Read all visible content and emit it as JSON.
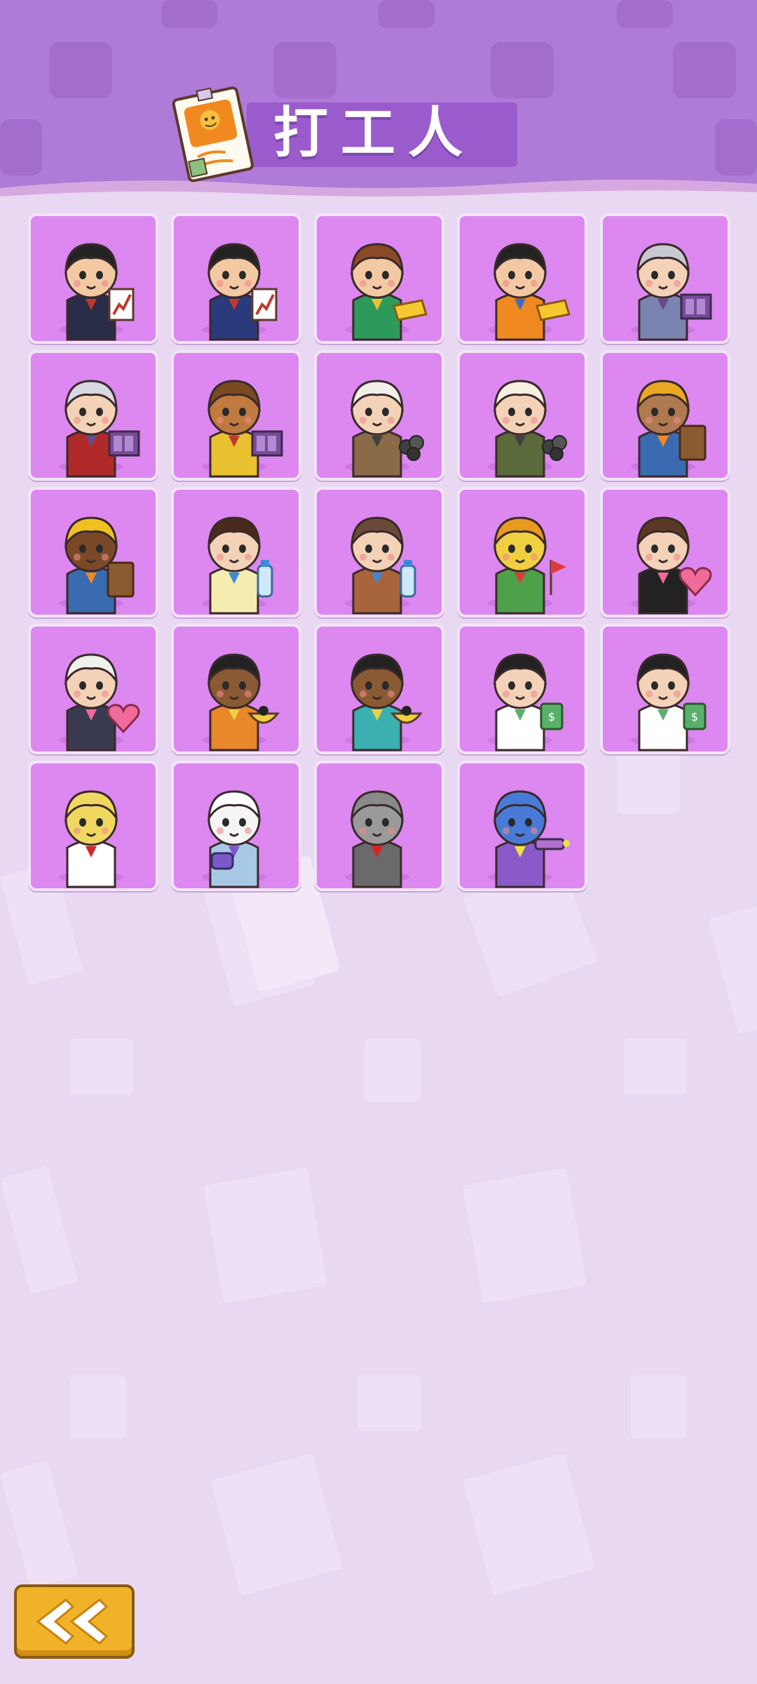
{
  "header": {
    "title": "打工人",
    "title_icon": "notice-paper-icon"
  },
  "roster": {
    "characters": [
      {
        "name": "office-man-chart",
        "skin": "#f3c9a4",
        "hair": "#222222",
        "shirt": "#2a2d48",
        "accent": "#c0392b",
        "prop": "chart"
      },
      {
        "name": "office-man-chart-2",
        "skin": "#f3c9a4",
        "hair": "#222222",
        "shirt": "#2a3a7a",
        "accent": "#c0392b",
        "prop": "chart"
      },
      {
        "name": "curler-lady-gold",
        "skin": "#f3c9a4",
        "hair": "#8a4a28",
        "shirt": "#2e9a5a",
        "accent": "#f0c030",
        "prop": "gold"
      },
      {
        "name": "boy-gold-bar",
        "skin": "#f3c9a4",
        "hair": "#222222",
        "shirt": "#f08a20",
        "accent": "#3a6ec8",
        "prop": "gold"
      },
      {
        "name": "silver-hair-book",
        "skin": "#f3d2b8",
        "hair": "#c8c8d0",
        "shirt": "#7a84b0",
        "accent": "#6a4a8a",
        "prop": "book"
      },
      {
        "name": "silver-hair-red-book",
        "skin": "#f3d2b8",
        "hair": "#d8d8e0",
        "shirt": "#b02a2a",
        "accent": "#6a4a8a",
        "prop": "book"
      },
      {
        "name": "monkey-king",
        "skin": "#c07a40",
        "hair": "#7a4a22",
        "shirt": "#e8c030",
        "accent": "#c0392b",
        "prop": "book"
      },
      {
        "name": "white-hair-adventurer",
        "skin": "#f3d2b8",
        "hair": "#f0f0e8",
        "shirt": "#8a6a48",
        "accent": "#404040",
        "prop": "coal"
      },
      {
        "name": "bun-girl-adventurer",
        "skin": "#f3d2b8",
        "hair": "#f5f0e0",
        "shirt": "#5a6a3a",
        "accent": "#404040",
        "prop": "coal"
      },
      {
        "name": "helmet-worker-brick",
        "skin": "#b07a50",
        "hair": "#e8a820",
        "shirt": "#3a6ab0",
        "accent": "#f08a20",
        "prop": "brick"
      },
      {
        "name": "helmet-worker-sunglasses",
        "skin": "#7a4a28",
        "hair": "#f0c020",
        "shirt": "#3a6ab0",
        "accent": "#f08a20",
        "prop": "brick"
      },
      {
        "name": "bun-girl-water",
        "skin": "#f3d2b8",
        "hair": "#4a2a1a",
        "shirt": "#f5ecb0",
        "accent": "#3a8ad8",
        "prop": "water"
      },
      {
        "name": "bald-boy-water",
        "skin": "#f3d2b8",
        "hair": "#6a4a38",
        "shirt": "#a8643a",
        "accent": "#3a8ad8",
        "prop": "water"
      },
      {
        "name": "parrot-flag",
        "skin": "#f0d040",
        "hair": "#e89a20",
        "shirt": "#4ea04a",
        "accent": "#e23a3a",
        "prop": "flag"
      },
      {
        "name": "maid-cat-heart",
        "skin": "#f3d2b8",
        "hair": "#5a3a24",
        "shirt": "#222222",
        "accent": "#f06a9a",
        "prop": "heart"
      },
      {
        "name": "wolf-girl-heart",
        "skin": "#f3d2b8",
        "hair": "#f0f0ec",
        "shirt": "#3a3a50",
        "accent": "#f06a9a",
        "prop": "heart"
      },
      {
        "name": "boy-orange-bowl",
        "skin": "#8a5a34",
        "hair": "#222222",
        "shirt": "#e8882a",
        "accent": "#f0d040",
        "prop": "bowl"
      },
      {
        "name": "boy-teal-bowl",
        "skin": "#8a5a34",
        "hair": "#222222",
        "shirt": "#3ab0b0",
        "accent": "#f0d040",
        "prop": "bowl"
      },
      {
        "name": "nurse-cash",
        "skin": "#f3d2b8",
        "hair": "#222222",
        "shirt": "#ffffff",
        "accent": "#5ab06a",
        "prop": "cash"
      },
      {
        "name": "doctor-cash",
        "skin": "#f3d2b8",
        "hair": "#222222",
        "shirt": "#ffffff",
        "accent": "#5ab06a",
        "prop": "cash"
      },
      {
        "name": "blonde-dog-girl",
        "skin": "#f0d860",
        "hair": "#f0d860",
        "shirt": "#ffffff",
        "accent": "#d02828",
        "prop": "none"
      },
      {
        "name": "sheep-purse",
        "skin": "#f5f5f5",
        "hair": "#ffffff",
        "shirt": "#a8c8e8",
        "accent": "#7a5ac8",
        "prop": "purse"
      },
      {
        "name": "robot-skull",
        "skin": "#9a9a9a",
        "hair": "#8a8a8a",
        "shirt": "#6a6a6a",
        "accent": "#e02020",
        "prop": "none"
      },
      {
        "name": "blue-alien-gun",
        "skin": "#4a7ad8",
        "hair": "#4a7ad8",
        "shirt": "#8a5ac8",
        "accent": "#f0e040",
        "prop": "gun"
      }
    ]
  },
  "back_button": {
    "icon": "chevron-left-icon"
  }
}
